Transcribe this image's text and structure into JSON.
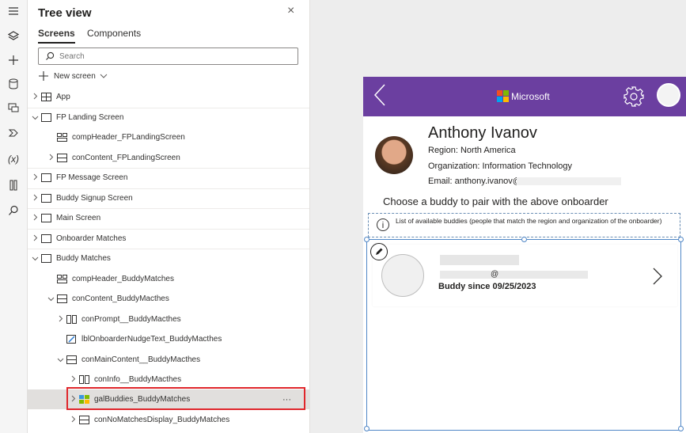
{
  "rail": {
    "icons": [
      "hamburger-icon",
      "layers-icon",
      "plus-icon",
      "database-icon",
      "media-icon",
      "data-flow-icon",
      "variables-icon",
      "tools-icon",
      "search-icon"
    ]
  },
  "panel": {
    "title": "Tree view",
    "close_glyph": "×",
    "tabs": [
      {
        "label": "Screens",
        "active": true
      },
      {
        "label": "Components",
        "active": false
      }
    ],
    "search_placeholder": "Search",
    "new_screen_label": "New screen"
  },
  "tree": [
    {
      "label": "App",
      "chevron": "right",
      "icon": "app",
      "indent": 0
    },
    {
      "label": "FP Landing Screen",
      "chevron": "down",
      "icon": "screen",
      "indent": 0
    },
    {
      "label": "compHeader_FPLandingScreen",
      "chevron": "",
      "icon": "component",
      "indent": 1
    },
    {
      "label": "conContent_FPLandingScreen",
      "chevron": "right",
      "icon": "vcontainer",
      "indent": 1
    },
    {
      "label": "FP Message Screen",
      "chevron": "right",
      "icon": "screen",
      "indent": 0
    },
    {
      "label": "Buddy Signup Screen",
      "chevron": "right",
      "icon": "screen",
      "indent": 0
    },
    {
      "label": "Main Screen",
      "chevron": "right",
      "icon": "screen",
      "indent": 0
    },
    {
      "label": "Onboarder Matches",
      "chevron": "right",
      "icon": "screen",
      "indent": 0
    },
    {
      "label": "Buddy Matches",
      "chevron": "down",
      "icon": "screen",
      "indent": 0
    },
    {
      "label": "compHeader_BuddyMatches",
      "chevron": "",
      "icon": "component",
      "indent": 1
    },
    {
      "label": "conContent_BuddyMacthes",
      "chevron": "down",
      "icon": "vcontainer",
      "indent": 1
    },
    {
      "label": "conPrompt__BuddyMacthes",
      "chevron": "right",
      "icon": "hcontainer",
      "indent": 2
    },
    {
      "label": "lblOnboarderNudgeText_BuddyMacthes",
      "chevron": "",
      "icon": "label",
      "indent": 2
    },
    {
      "label": "conMainContent__BuddyMacthes",
      "chevron": "down",
      "icon": "vcontainer",
      "indent": 2
    },
    {
      "label": "conInfo__BuddyMacthes",
      "chevron": "right",
      "icon": "hcontainer",
      "indent": 3
    },
    {
      "label": "galBuddies_BuddyMatches",
      "chevron": "right",
      "icon": "gallery",
      "indent": 3,
      "selected": true
    },
    {
      "label": "conNoMatchesDisplay_BuddyMatches",
      "chevron": "right",
      "icon": "vcontainer",
      "indent": 3
    }
  ],
  "selected_more": "···",
  "app": {
    "back_glyph": "‹",
    "brand": "Microsoft",
    "brand_colors": [
      "#f25022",
      "#7fba00",
      "#00a4ef",
      "#ffb900"
    ],
    "header_color": "#6b3fa0",
    "user": {
      "name": "Anthony Ivanov",
      "region": "Region: North America",
      "organization": "Organization: Information Technology",
      "email": "Email: anthony.ivanov@"
    },
    "prompt": "Choose a buddy to pair with the above onboarder",
    "info_text": "List of available buddies (people that match the region and organization of the onboarder)",
    "info_glyph": "i",
    "buddy": {
      "at": "@",
      "since": "Buddy since 09/25/2023"
    }
  }
}
